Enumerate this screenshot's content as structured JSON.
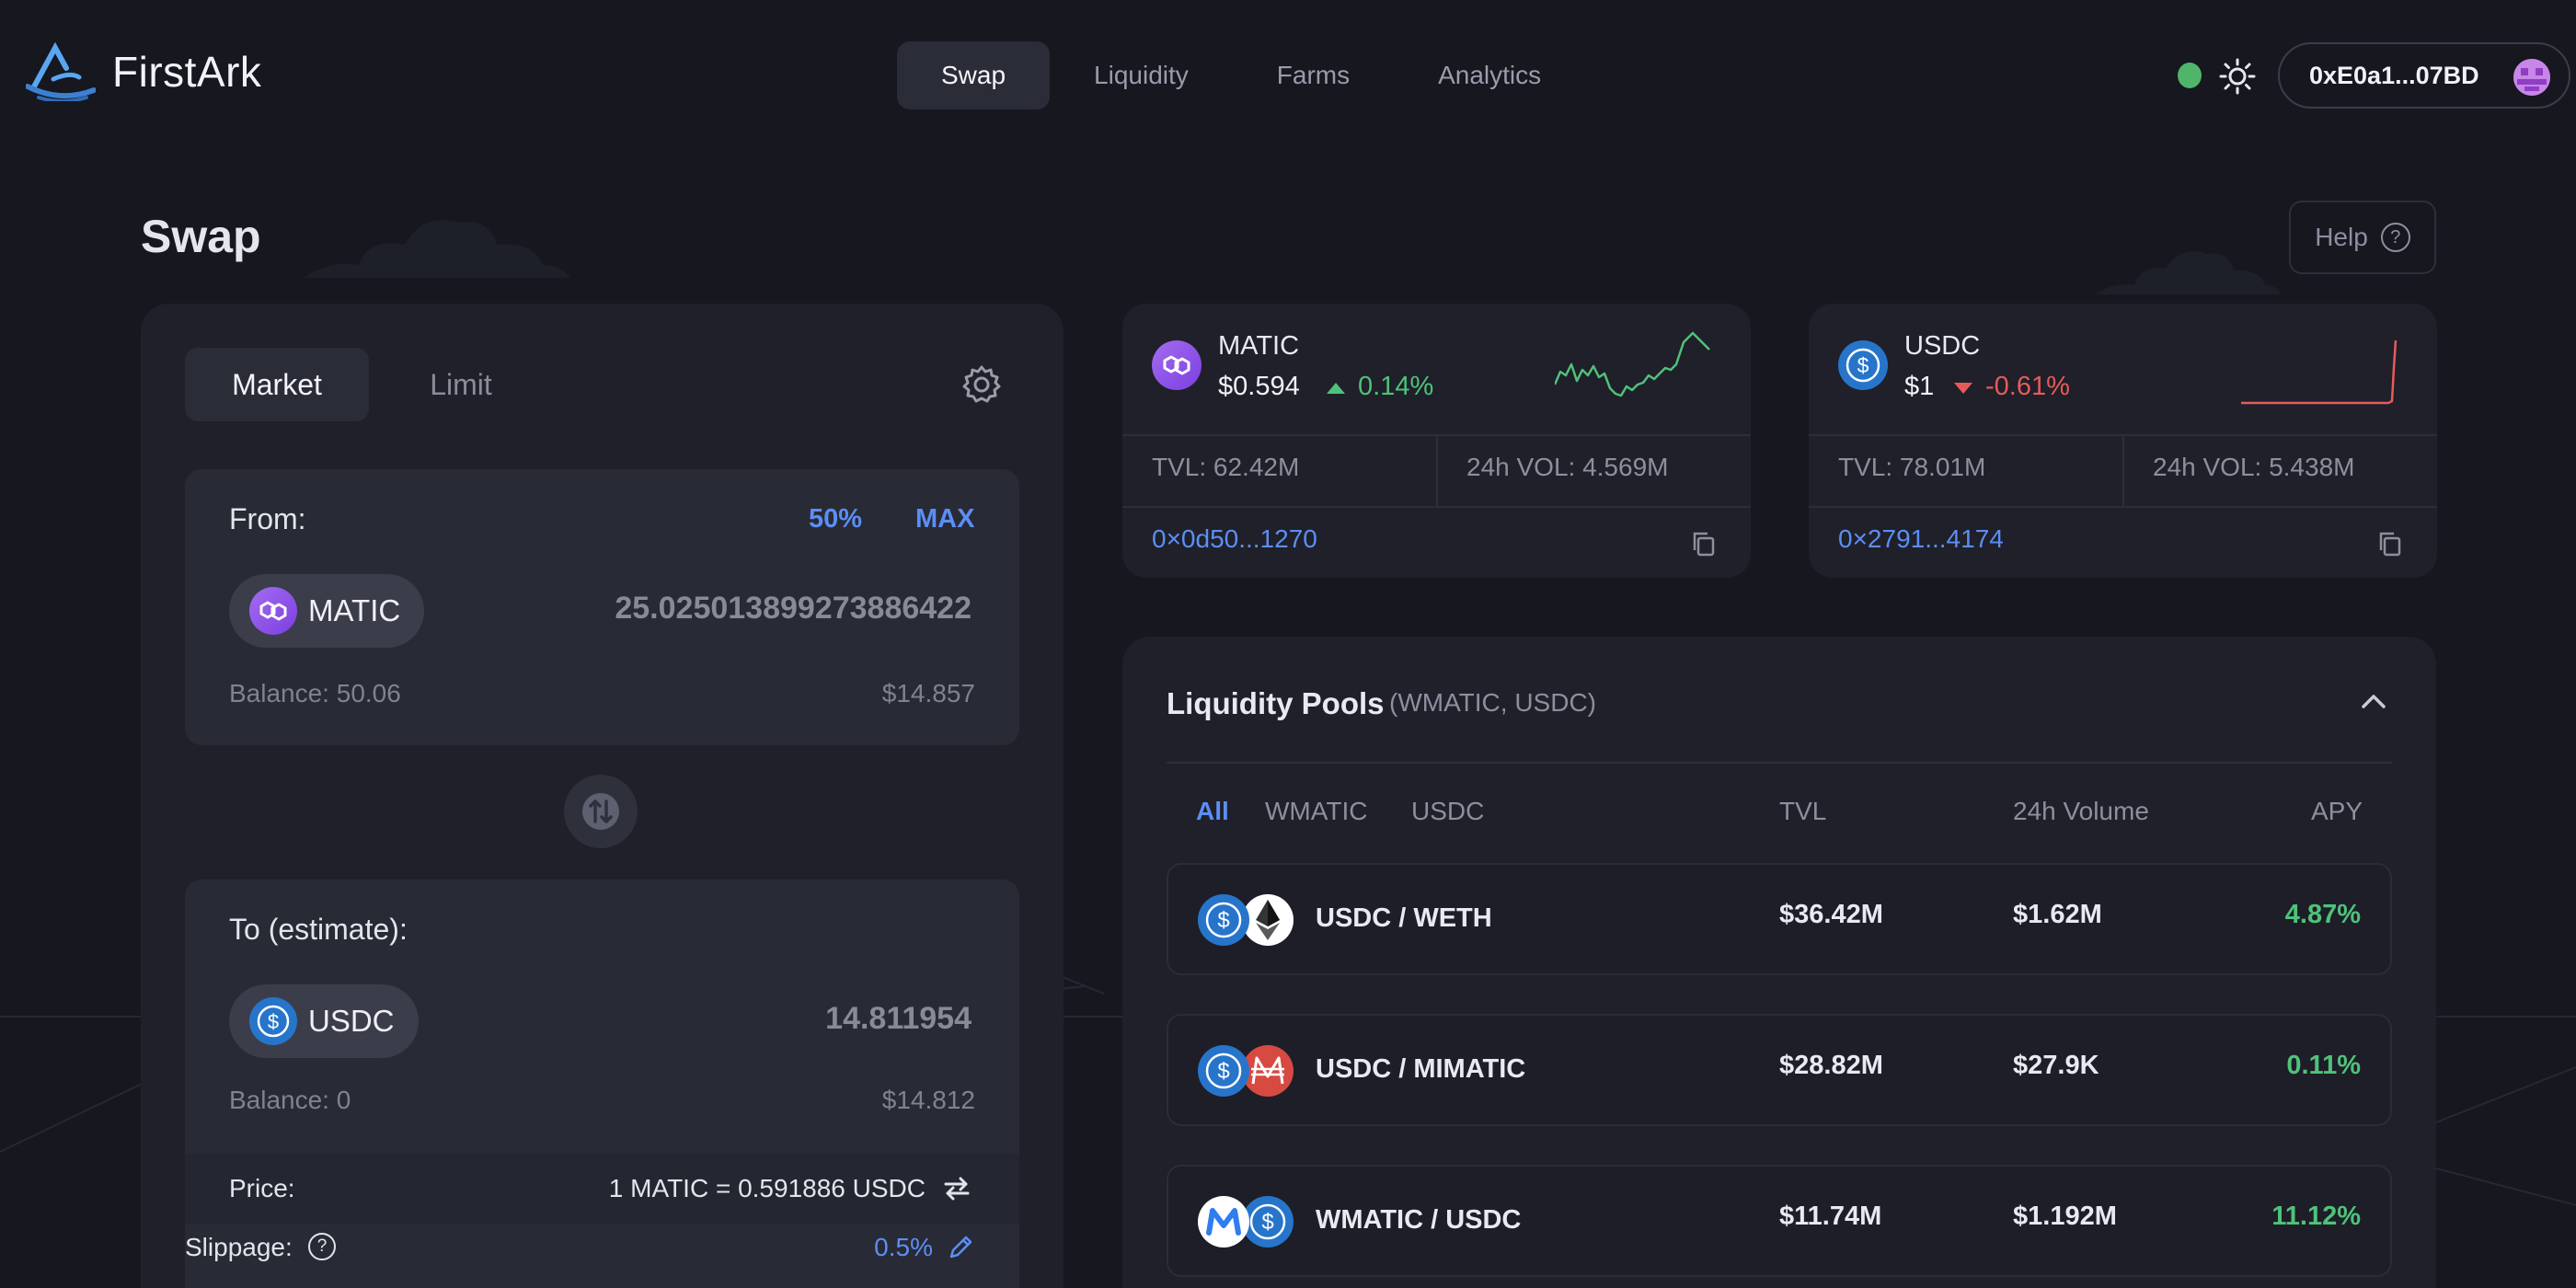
{
  "app": {
    "name": "FirstArk"
  },
  "nav": {
    "items": [
      "Swap",
      "Liquidity",
      "Farms",
      "Analytics"
    ],
    "active": "Swap"
  },
  "wallet": {
    "address": "0xE0a1...07BD",
    "status_color": "#4fb56b"
  },
  "page": {
    "title": "Swap",
    "help_label": "Help"
  },
  "swap": {
    "tabs": [
      "Market",
      "Limit"
    ],
    "active_tab": "Market",
    "from": {
      "label": "From:",
      "half_label": "50%",
      "max_label": "MAX",
      "token": "MATIC",
      "amount": "25.025013899273886422",
      "balance": "Balance: 50.06",
      "usd": "$14.857"
    },
    "to": {
      "label": "To (estimate):",
      "token": "USDC",
      "amount": "14.811954",
      "balance": "Balance: 0",
      "usd": "$14.812"
    },
    "price": {
      "label": "Price:",
      "value": "1 MATIC = 0.591886 USDC"
    },
    "slippage": {
      "label": "Slippage:",
      "value": "0.5%"
    }
  },
  "token_cards": [
    {
      "name": "MATIC",
      "price": "$0.594",
      "change": "0.14%",
      "direction": "up",
      "tvl": "TVL: 62.42M",
      "volume": "24h VOL: 4.569M",
      "address": "0×0d50...1270",
      "color": "#8247e5"
    },
    {
      "name": "USDC",
      "price": "$1",
      "change": "-0.61%",
      "direction": "down",
      "tvl": "TVL: 78.01M",
      "volume": "24h VOL: 5.438M",
      "address": "0×2791...4174",
      "color": "#2775ca"
    }
  ],
  "pools": {
    "title": "Liquidity Pools",
    "subtitle": "(WMATIC, USDC)",
    "filters": [
      "All",
      "WMATIC",
      "USDC"
    ],
    "active_filter": "All",
    "columns": [
      "TVL",
      "24h Volume",
      "APY"
    ],
    "rows": [
      {
        "pair": "USDC / WETH",
        "tvl": "$36.42M",
        "volume": "$1.62M",
        "apy": "4.87%",
        "icons": [
          "usdc-icon",
          "weth-icon"
        ]
      },
      {
        "pair": "USDC / MIMATIC",
        "tvl": "$28.82M",
        "volume": "$27.9K",
        "apy": "0.11%",
        "icons": [
          "usdc-icon",
          "mimatic-icon"
        ]
      },
      {
        "pair": "WMATIC / USDC",
        "tvl": "$11.74M",
        "volume": "$1.192M",
        "apy": "11.12%",
        "icons": [
          "wmatic-icon",
          "usdc-icon"
        ]
      }
    ]
  },
  "colors": {
    "accent": "#5c8ef5",
    "positive": "#4fc27a",
    "negative": "#e85a5a",
    "background": "#16171f",
    "card": "#1f2029"
  }
}
